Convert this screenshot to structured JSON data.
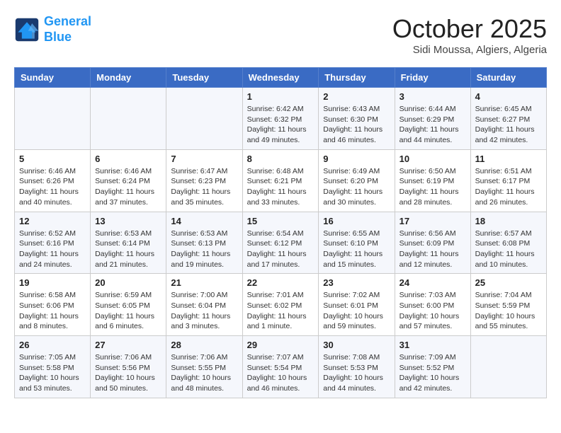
{
  "header": {
    "logo_line1": "General",
    "logo_line2": "Blue",
    "month": "October 2025",
    "location": "Sidi Moussa, Algiers, Algeria"
  },
  "weekdays": [
    "Sunday",
    "Monday",
    "Tuesday",
    "Wednesday",
    "Thursday",
    "Friday",
    "Saturday"
  ],
  "weeks": [
    [
      {
        "day": "",
        "info": ""
      },
      {
        "day": "",
        "info": ""
      },
      {
        "day": "",
        "info": ""
      },
      {
        "day": "1",
        "info": "Sunrise: 6:42 AM\nSunset: 6:32 PM\nDaylight: 11 hours\nand 49 minutes."
      },
      {
        "day": "2",
        "info": "Sunrise: 6:43 AM\nSunset: 6:30 PM\nDaylight: 11 hours\nand 46 minutes."
      },
      {
        "day": "3",
        "info": "Sunrise: 6:44 AM\nSunset: 6:29 PM\nDaylight: 11 hours\nand 44 minutes."
      },
      {
        "day": "4",
        "info": "Sunrise: 6:45 AM\nSunset: 6:27 PM\nDaylight: 11 hours\nand 42 minutes."
      }
    ],
    [
      {
        "day": "5",
        "info": "Sunrise: 6:46 AM\nSunset: 6:26 PM\nDaylight: 11 hours\nand 40 minutes."
      },
      {
        "day": "6",
        "info": "Sunrise: 6:46 AM\nSunset: 6:24 PM\nDaylight: 11 hours\nand 37 minutes."
      },
      {
        "day": "7",
        "info": "Sunrise: 6:47 AM\nSunset: 6:23 PM\nDaylight: 11 hours\nand 35 minutes."
      },
      {
        "day": "8",
        "info": "Sunrise: 6:48 AM\nSunset: 6:21 PM\nDaylight: 11 hours\nand 33 minutes."
      },
      {
        "day": "9",
        "info": "Sunrise: 6:49 AM\nSunset: 6:20 PM\nDaylight: 11 hours\nand 30 minutes."
      },
      {
        "day": "10",
        "info": "Sunrise: 6:50 AM\nSunset: 6:19 PM\nDaylight: 11 hours\nand 28 minutes."
      },
      {
        "day": "11",
        "info": "Sunrise: 6:51 AM\nSunset: 6:17 PM\nDaylight: 11 hours\nand 26 minutes."
      }
    ],
    [
      {
        "day": "12",
        "info": "Sunrise: 6:52 AM\nSunset: 6:16 PM\nDaylight: 11 hours\nand 24 minutes."
      },
      {
        "day": "13",
        "info": "Sunrise: 6:53 AM\nSunset: 6:14 PM\nDaylight: 11 hours\nand 21 minutes."
      },
      {
        "day": "14",
        "info": "Sunrise: 6:53 AM\nSunset: 6:13 PM\nDaylight: 11 hours\nand 19 minutes."
      },
      {
        "day": "15",
        "info": "Sunrise: 6:54 AM\nSunset: 6:12 PM\nDaylight: 11 hours\nand 17 minutes."
      },
      {
        "day": "16",
        "info": "Sunrise: 6:55 AM\nSunset: 6:10 PM\nDaylight: 11 hours\nand 15 minutes."
      },
      {
        "day": "17",
        "info": "Sunrise: 6:56 AM\nSunset: 6:09 PM\nDaylight: 11 hours\nand 12 minutes."
      },
      {
        "day": "18",
        "info": "Sunrise: 6:57 AM\nSunset: 6:08 PM\nDaylight: 11 hours\nand 10 minutes."
      }
    ],
    [
      {
        "day": "19",
        "info": "Sunrise: 6:58 AM\nSunset: 6:06 PM\nDaylight: 11 hours\nand 8 minutes."
      },
      {
        "day": "20",
        "info": "Sunrise: 6:59 AM\nSunset: 6:05 PM\nDaylight: 11 hours\nand 6 minutes."
      },
      {
        "day": "21",
        "info": "Sunrise: 7:00 AM\nSunset: 6:04 PM\nDaylight: 11 hours\nand 3 minutes."
      },
      {
        "day": "22",
        "info": "Sunrise: 7:01 AM\nSunset: 6:02 PM\nDaylight: 11 hours\nand 1 minute."
      },
      {
        "day": "23",
        "info": "Sunrise: 7:02 AM\nSunset: 6:01 PM\nDaylight: 10 hours\nand 59 minutes."
      },
      {
        "day": "24",
        "info": "Sunrise: 7:03 AM\nSunset: 6:00 PM\nDaylight: 10 hours\nand 57 minutes."
      },
      {
        "day": "25",
        "info": "Sunrise: 7:04 AM\nSunset: 5:59 PM\nDaylight: 10 hours\nand 55 minutes."
      }
    ],
    [
      {
        "day": "26",
        "info": "Sunrise: 7:05 AM\nSunset: 5:58 PM\nDaylight: 10 hours\nand 53 minutes."
      },
      {
        "day": "27",
        "info": "Sunrise: 7:06 AM\nSunset: 5:56 PM\nDaylight: 10 hours\nand 50 minutes."
      },
      {
        "day": "28",
        "info": "Sunrise: 7:06 AM\nSunset: 5:55 PM\nDaylight: 10 hours\nand 48 minutes."
      },
      {
        "day": "29",
        "info": "Sunrise: 7:07 AM\nSunset: 5:54 PM\nDaylight: 10 hours\nand 46 minutes."
      },
      {
        "day": "30",
        "info": "Sunrise: 7:08 AM\nSunset: 5:53 PM\nDaylight: 10 hours\nand 44 minutes."
      },
      {
        "day": "31",
        "info": "Sunrise: 7:09 AM\nSunset: 5:52 PM\nDaylight: 10 hours\nand 42 minutes."
      },
      {
        "day": "",
        "info": ""
      }
    ]
  ]
}
